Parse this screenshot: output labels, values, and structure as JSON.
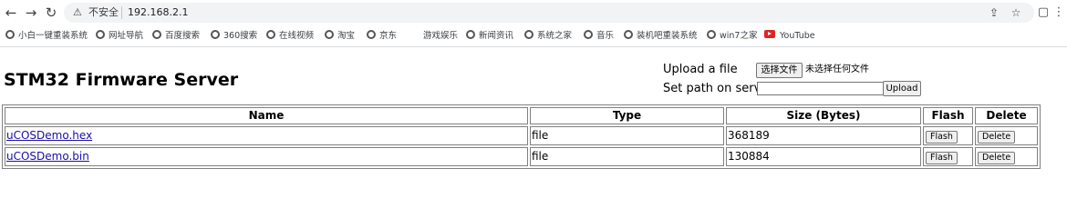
{
  "browser": {
    "nav": {
      "back_icon": "arrow-left-icon",
      "forward_icon": "arrow-right-icon",
      "reload_icon": "reload-icon"
    },
    "security_label": "不安全",
    "url": "192.168.2.1",
    "bookmarks": [
      {
        "label": "小白一键重装系统",
        "icon": "globe-icon"
      },
      {
        "label": "网址导航",
        "icon": "globe-icon"
      },
      {
        "label": "百度搜索",
        "icon": "globe-icon"
      },
      {
        "label": "360搜索",
        "icon": "globe-icon"
      },
      {
        "label": "在线视频",
        "icon": "globe-icon"
      },
      {
        "label": "淘宝",
        "icon": "globe-icon"
      },
      {
        "label": "京东",
        "icon": "globe-icon"
      },
      {
        "label": "游戏娱乐",
        "icon": "none"
      },
      {
        "label": "新闻资讯",
        "icon": "globe-icon"
      },
      {
        "label": "系统之家",
        "icon": "globe-icon"
      },
      {
        "label": "音乐",
        "icon": "globe-icon"
      },
      {
        "label": "装机吧重装系统",
        "icon": "globe-icon"
      },
      {
        "label": "win7之家",
        "icon": "globe-icon"
      },
      {
        "label": "YouTube",
        "icon": "youtube-icon"
      }
    ]
  },
  "page": {
    "title": "STM32 Firmware Server",
    "upload_label": "Upload a file",
    "choose_file_button": "选择文件",
    "no_file_text": "未选择任何文件",
    "path_label": "Set path on server",
    "path_value": "",
    "upload_button": "Upload"
  },
  "table": {
    "headers": {
      "name": "Name",
      "type": "Type",
      "size": "Size (Bytes)",
      "flash": "Flash",
      "delete": "Delete"
    },
    "rows": [
      {
        "name": "uCOSDemo.hex",
        "type": "file",
        "size": "368189",
        "flash": "Flash",
        "delete": "Delete"
      },
      {
        "name": "uCOSDemo.bin",
        "type": "file",
        "size": "130884",
        "flash": "Flash",
        "delete": "Delete"
      }
    ]
  }
}
